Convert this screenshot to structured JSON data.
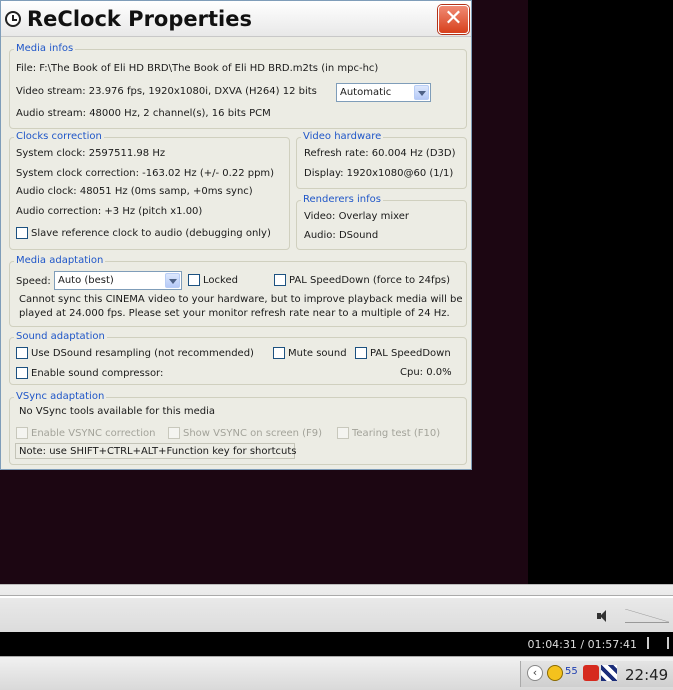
{
  "dialog": {
    "title": "ReClock Properties",
    "close_glyph": "✕"
  },
  "media_infos": {
    "legend": "Media infos",
    "file": "File:  F:\\The Book of Eli HD BRD\\The Book of Eli HD BRD.m2ts (in mpc-hc)",
    "video_stream": "Video stream:  23.976 fps, 1920x1080i, DXVA (H264) 12 bits",
    "audio_stream": "Audio stream:  48000 Hz, 2 channel(s), 16 bits PCM",
    "video_mode": "Automatic"
  },
  "clocks": {
    "legend": "Clocks correction",
    "system_clock": "System clock:  2597511.98 Hz",
    "system_correction": "System clock correction:  -163.02 Hz (+/- 0.22 ppm)",
    "audio_clock": "Audio clock:  48051 Hz (0ms samp, +0ms sync)",
    "audio_correction": "Audio correction: +3 Hz (pitch x1.00)",
    "slave_label": "Slave reference clock to audio (debugging only)"
  },
  "video_hw": {
    "legend": "Video hardware",
    "refresh": "Refresh rate:  60.004 Hz (D3D)",
    "display": "Display:  1920x1080@60 (1/1)"
  },
  "renderers": {
    "legend": "Renderers infos",
    "video": "Video: Overlay mixer",
    "audio": "Audio: DSound"
  },
  "media_adapt": {
    "legend": "Media adaptation",
    "speed_label": "Speed:",
    "speed_value": "Auto (best)",
    "locked_label": "Locked",
    "pal_label": "PAL SpeedDown (force to 24fps)",
    "message_line1": "Cannot sync this CINEMA video to your hardware, but to improve playback media will be",
    "message_line2": "played at 24.000 fps. Please set your monitor refresh rate near to a multiple of 24 Hz."
  },
  "sound_adapt": {
    "legend": "Sound adaptation",
    "dsound_label": "Use DSound resampling (not recommended)",
    "mute_label": "Mute sound",
    "pal_label": "PAL SpeedDown",
    "compressor_label": "Enable sound compressor:",
    "cpu": "Cpu:  0.0%"
  },
  "vsync": {
    "legend": "VSync adaptation",
    "status": "No VSync tools available for this media",
    "enable_label": "Enable VSYNC correction",
    "show_label": "Show VSYNC on screen (F9)",
    "tearing_label": "Tearing test (F10)",
    "note": "Note: use SHIFT+CTRL+ALT+Function key for shortcuts"
  },
  "player": {
    "time": "01:04:31 / 01:57:41"
  },
  "taskbar": {
    "tray_arrow": "‹",
    "tray_count": "55",
    "clock": "22:49"
  }
}
